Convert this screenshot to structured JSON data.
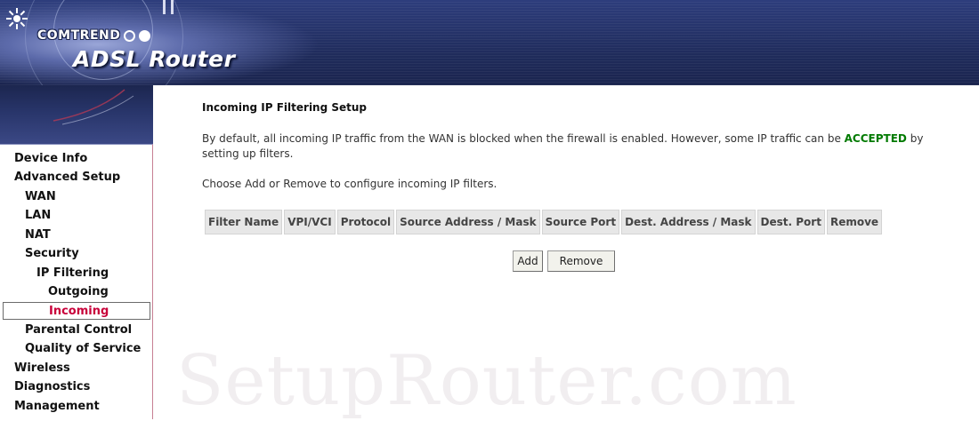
{
  "header": {
    "brand": "COMTREND",
    "product": "ADSL Router"
  },
  "sidebar": {
    "items": [
      {
        "label": "Device Info",
        "level": 0,
        "active": false
      },
      {
        "label": "Advanced Setup",
        "level": 0,
        "active": false
      },
      {
        "label": "WAN",
        "level": 1,
        "active": false
      },
      {
        "label": "LAN",
        "level": 1,
        "active": false
      },
      {
        "label": "NAT",
        "level": 1,
        "active": false
      },
      {
        "label": "Security",
        "level": 1,
        "active": false
      },
      {
        "label": "IP Filtering",
        "level": 2,
        "active": false
      },
      {
        "label": "Outgoing",
        "level": 3,
        "active": false
      },
      {
        "label": "Incoming",
        "level": 3,
        "active": true
      },
      {
        "label": "Parental Control",
        "level": 1,
        "active": false
      },
      {
        "label": "Quality of Service",
        "level": 1,
        "active": false
      },
      {
        "label": "Wireless",
        "level": 0,
        "active": false
      },
      {
        "label": "Diagnostics",
        "level": 0,
        "active": false
      },
      {
        "label": "Management",
        "level": 0,
        "active": false
      }
    ],
    "active_color": "#c8003a"
  },
  "main": {
    "title": "Incoming IP Filtering Setup",
    "description_before": "By default, all incoming IP traffic from the WAN is blocked when the firewall is enabled. However, some IP traffic can be ",
    "description_highlight": "ACCEPTED",
    "description_after": " by setting up filters.",
    "instruction": "Choose Add or Remove to configure incoming IP filters.",
    "table": {
      "columns": [
        "Filter Name",
        "VPI/VCI",
        "Protocol",
        "Source Address / Mask",
        "Source Port",
        "Dest. Address / Mask",
        "Dest. Port",
        "Remove"
      ],
      "rows": []
    },
    "add_label": "Add",
    "remove_label": "Remove"
  },
  "watermark": "SetupRouter.com",
  "colors": {
    "accent_green": "#007a00",
    "header_blue": "#27356d"
  }
}
